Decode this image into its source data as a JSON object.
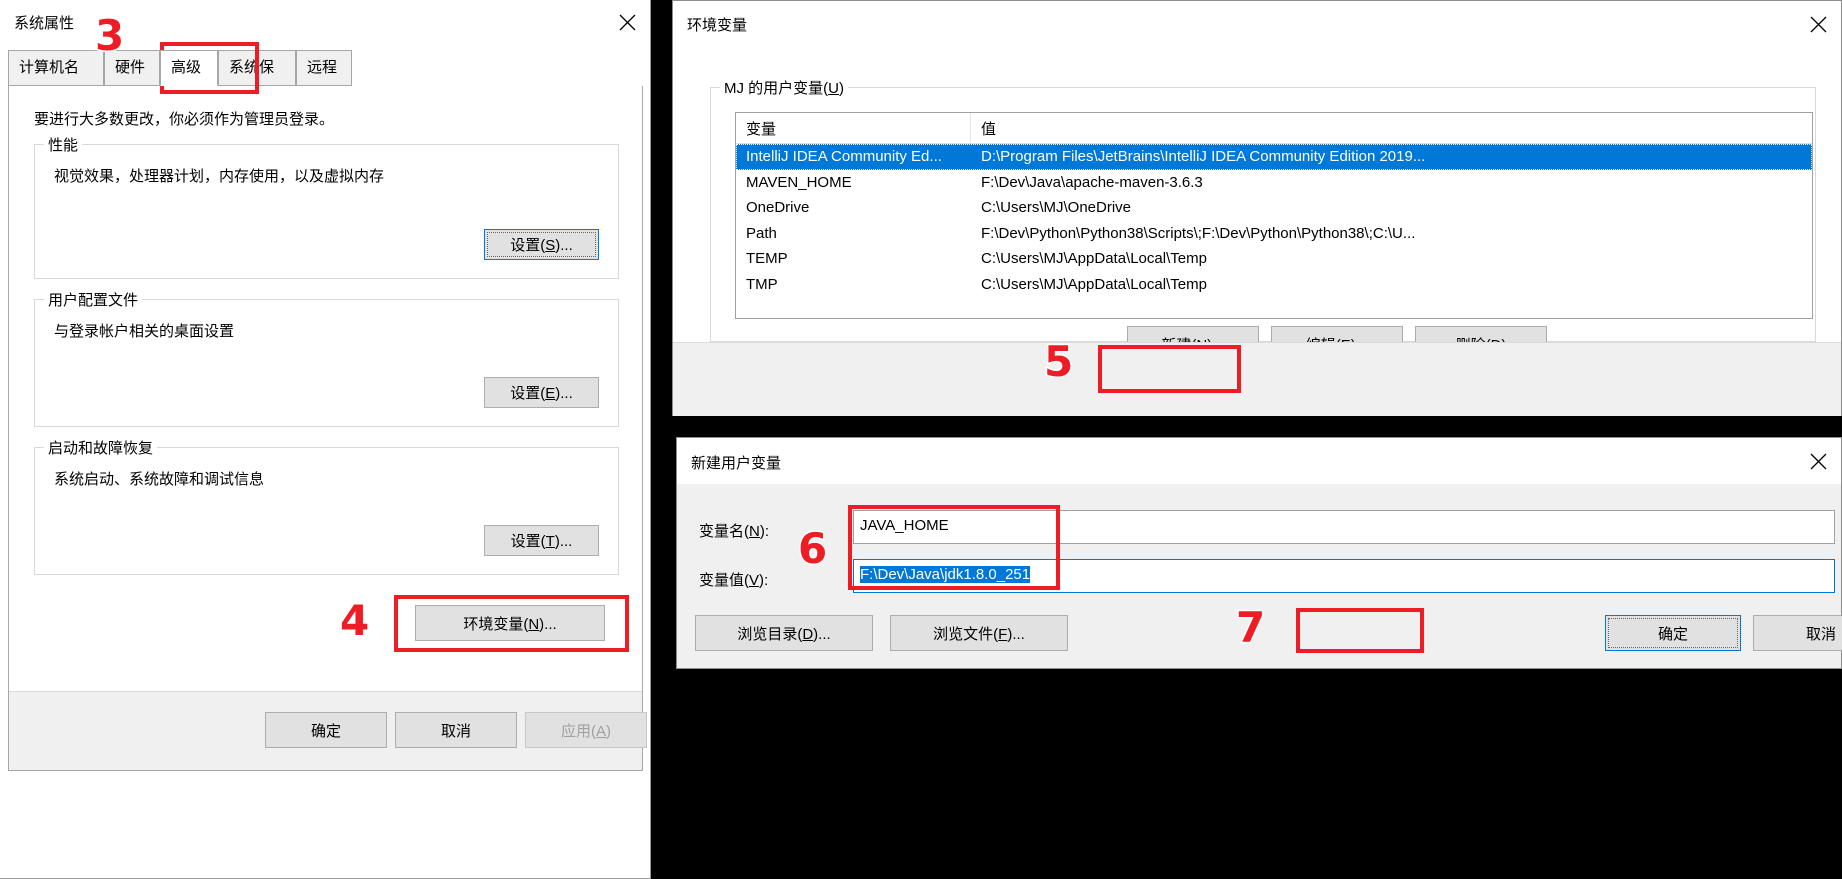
{
  "system_properties": {
    "title": "系统属性",
    "tabs": [
      {
        "label": "计算机名"
      },
      {
        "label": "硬件"
      },
      {
        "label": "高级"
      },
      {
        "label": "系统保护"
      },
      {
        "label": "远程"
      }
    ],
    "active_tab": "高级",
    "hint": "要进行大多数更改，你必须作为管理员登录。",
    "groups": [
      {
        "legend": "性能",
        "text": "视觉效果，处理器计划，内存使用，以及虚拟内存",
        "button": "设置(S)..."
      },
      {
        "legend": "用户配置文件",
        "text": "与登录帐户相关的桌面设置",
        "button": "设置(E)..."
      },
      {
        "legend": "启动和故障恢复",
        "text": "系统启动、系统故障和调试信息",
        "button": "设置(T)..."
      }
    ],
    "env_button": "环境变量(N)...",
    "footer": {
      "ok": "确定",
      "cancel": "取消",
      "apply": "应用(A)"
    }
  },
  "environment_variables": {
    "title": "环境变量",
    "group_legend": "MJ 的用户变量(U)",
    "columns": [
      "变量",
      "值"
    ],
    "rows": [
      {
        "name": "IntelliJ IDEA Community Ed...",
        "value": "D:\\Program Files\\JetBrains\\IntelliJ IDEA Community Edition 2019...",
        "selected": true
      },
      {
        "name": "MAVEN_HOME",
        "value": "F:\\Dev\\Java\\apache-maven-3.6.3",
        "selected": false
      },
      {
        "name": "OneDrive",
        "value": "C:\\Users\\MJ\\OneDrive",
        "selected": false
      },
      {
        "name": "Path",
        "value": "F:\\Dev\\Python\\Python38\\Scripts\\;F:\\Dev\\Python\\Python38\\;C:\\U...",
        "selected": false
      },
      {
        "name": "TEMP",
        "value": "C:\\Users\\MJ\\AppData\\Local\\Temp",
        "selected": false
      },
      {
        "name": "TMP",
        "value": "C:\\Users\\MJ\\AppData\\Local\\Temp",
        "selected": false
      }
    ],
    "buttons": {
      "new": "新建(N)...",
      "edit": "编辑(E)...",
      "delete": "删除(D)"
    }
  },
  "new_user_variable": {
    "title": "新建用户变量",
    "name_label": "变量名(N):",
    "name_value": "JAVA_HOME",
    "value_label": "变量值(V):",
    "value_value": "F:\\Dev\\Java\\jdk1.8.0_251",
    "browse_dir": "浏览目录(D)...",
    "browse_file": "浏览文件(F)...",
    "ok": "确定",
    "cancel": "取消"
  },
  "annotations": {
    "step3": "3",
    "step4": "4",
    "step5": "5",
    "step6": "6",
    "step7": "7"
  },
  "colors": {
    "accent": "#0078d7",
    "annotation_red": "#ee1c25",
    "window_bg": "#f0f0f0"
  }
}
